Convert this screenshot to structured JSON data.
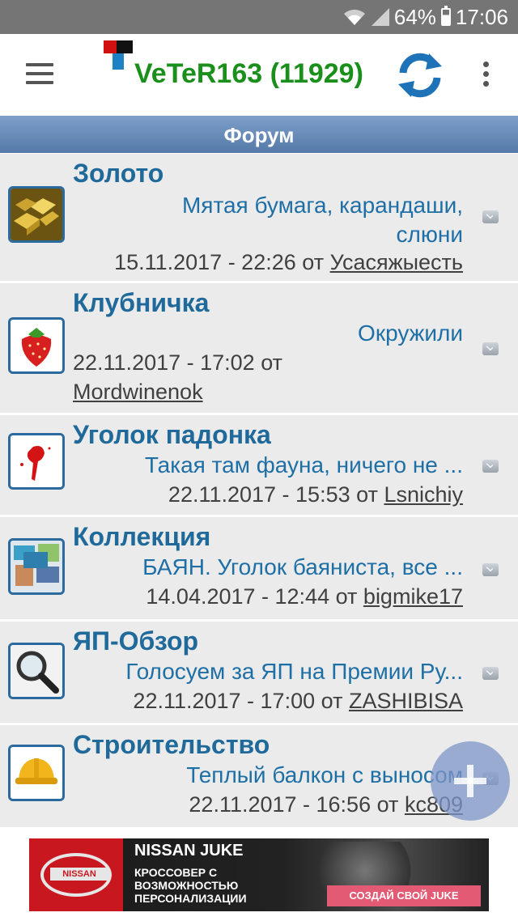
{
  "status_bar": {
    "battery_percent": "64%",
    "time": "17:06",
    "icons": [
      "wifi-icon",
      "signal-icon",
      "battery-icon"
    ]
  },
  "app_bar": {
    "title": "VeTeR163 (11929)",
    "title_color": "#1b8f1b",
    "icons": [
      "menu-icon",
      "logo-icon",
      "refresh-icon",
      "more-icon"
    ]
  },
  "section": {
    "title": "Форум"
  },
  "forums": [
    {
      "title": "Золото",
      "icon": "gold-bars-icon",
      "last_topic": "Мятая бумага, карандаши, слюни",
      "date": "15.11.2017 - 22:26",
      "from_label": "от",
      "user": "Усасяжыесть"
    },
    {
      "title": "Клубничка",
      "icon": "strawberry-icon",
      "last_topic": "Окружили",
      "date": "22.11.2017 - 17:02",
      "from_label": "от",
      "user": "Mordwinenok"
    },
    {
      "title": "Уголок падонка",
      "icon": "red-blot-icon",
      "last_topic": "Такая там фауна, ничего не ...",
      "date": "22.11.2017 - 15:53",
      "from_label": "от",
      "user": "Lsnichiy"
    },
    {
      "title": "Коллекция",
      "icon": "photo-collage-icon",
      "last_topic": "БАЯН. Уголок баяниста, все ...",
      "date": "14.04.2017 - 12:44",
      "from_label": "от",
      "user": "bigmike17"
    },
    {
      "title": "ЯП-Обзор",
      "icon": "magnifier-icon",
      "last_topic": "Голосуем за ЯП на Премии Ру...",
      "date": "22.11.2017 - 17:00",
      "from_label": "от",
      "user": "ZASHIBISA"
    },
    {
      "title": "Строительство",
      "icon": "hard-hat-icon",
      "last_topic": "Теплый балкон с выносом",
      "date": "22.11.2017 - 16:56",
      "from_label": "от",
      "user": "kc809"
    }
  ],
  "fab": {
    "icon": "plus-icon"
  },
  "ad": {
    "logo_text": "NISSAN",
    "title": "NISSAN JUKE",
    "subtitle": "КРОССОВЕР С ВОЗМОЖНОСТЬЮ ПЕРСОНАЛИЗАЦИИ",
    "cta": "СОЗДАЙ СВОЙ JUKE"
  },
  "colors": {
    "section_header": "#5f83b3",
    "forum_title": "#1f6a9a",
    "last_topic": "#1e6fa5",
    "meta_text": "#404040",
    "row_background": "#ebebeb"
  }
}
